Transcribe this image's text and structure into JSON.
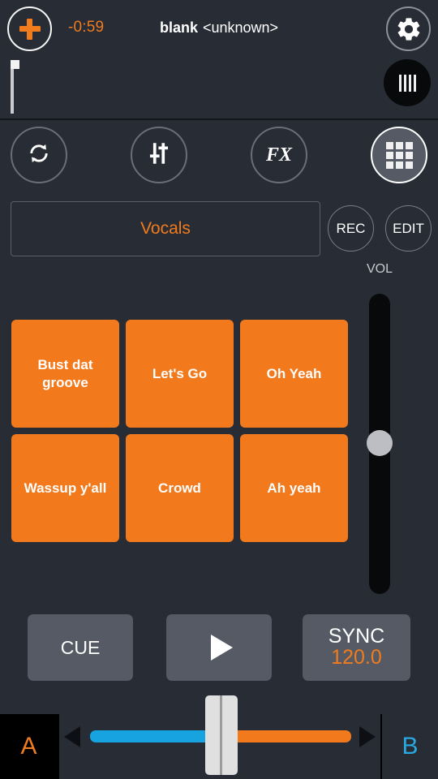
{
  "header": {
    "add_button_icon": "plus-icon",
    "time_remaining": "-0:59",
    "track_name": "blank",
    "track_artist": "<unknown>",
    "settings_icon": "gear-icon",
    "beat_button_icon": "beatgrid-bars-icon"
  },
  "modes": [
    {
      "name": "loop",
      "icon": "loop-arrows-icon",
      "label": "",
      "active": false
    },
    {
      "name": "eq",
      "icon": "sliders-icon",
      "label": "",
      "active": false
    },
    {
      "name": "fx",
      "icon": "fx-text-icon",
      "label": "FX",
      "active": false
    },
    {
      "name": "pads",
      "icon": "grid-3x3-icon",
      "label": "",
      "active": true
    }
  ],
  "bank": {
    "selected": "Vocals",
    "rec_label": "REC",
    "edit_label": "EDIT"
  },
  "volume": {
    "label": "VOL",
    "value_percent": 53
  },
  "pads": [
    {
      "label": "Bust dat groove"
    },
    {
      "label": "Let's Go"
    },
    {
      "label": "Oh Yeah"
    },
    {
      "label": "Wassup y'all"
    },
    {
      "label": "Crowd"
    },
    {
      "label": "Ah yeah"
    }
  ],
  "transport": {
    "cue_label": "CUE",
    "play_icon": "play-triangle-icon",
    "sync_label": "SYNC",
    "bpm": "120.0"
  },
  "crossfader": {
    "deck_a_label": "A",
    "deck_b_label": "B",
    "position_percent": 50,
    "left_color": "#17a3e0",
    "right_color": "#f2791c"
  },
  "colors": {
    "background": "#282c35",
    "accent_orange": "#f07c1e",
    "accent_cyan": "#29a8e0",
    "pad_orange": "#f2791c",
    "button_gray": "#555a64"
  }
}
